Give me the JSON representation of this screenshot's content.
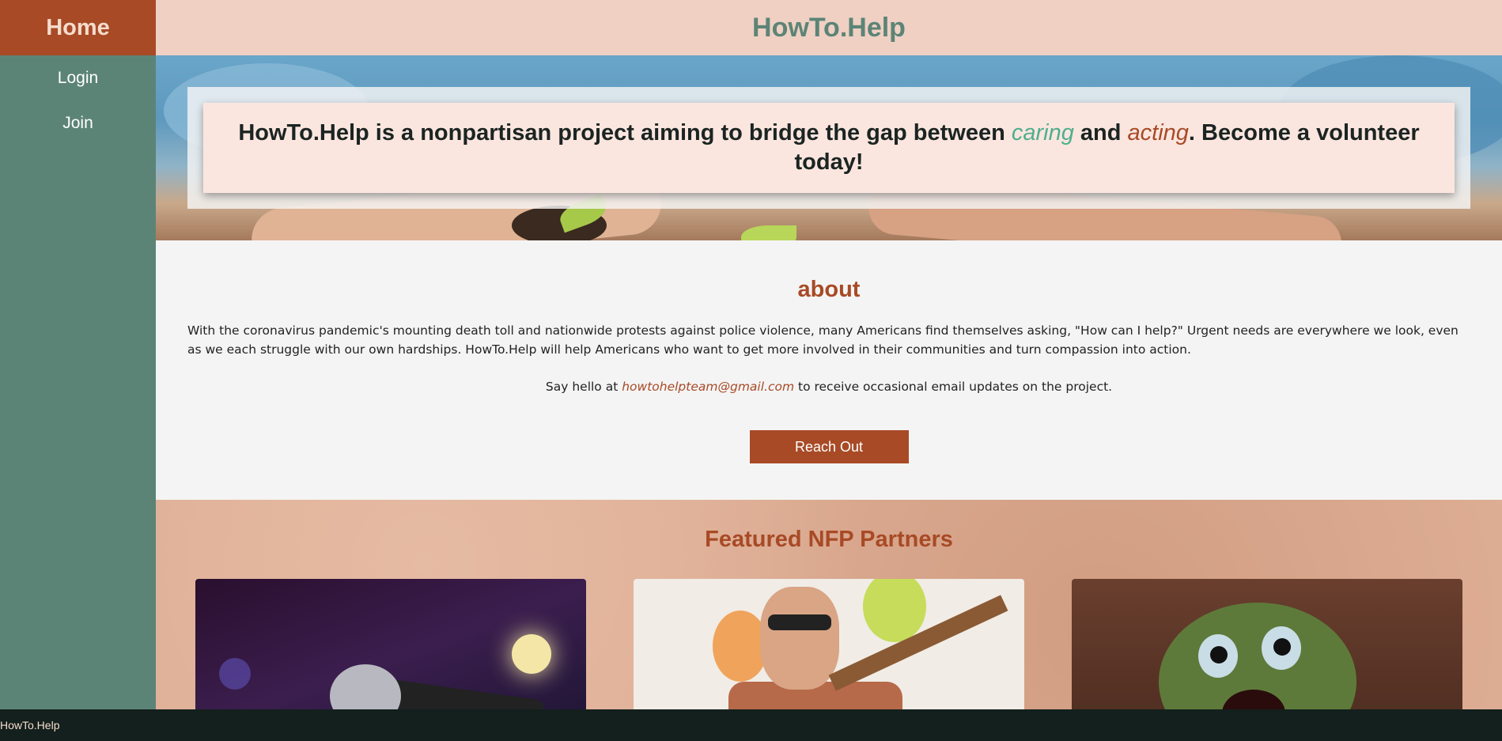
{
  "sidebar": {
    "home_label": "Home",
    "items": [
      {
        "label": "Login"
      },
      {
        "label": "Join"
      }
    ]
  },
  "header": {
    "title": "HowTo.Help"
  },
  "hero": {
    "text_before": "HowTo.Help is a nonpartisan project aiming to bridge the gap between ",
    "word_caring": "caring",
    "text_and": " and ",
    "word_acting": "acting",
    "text_after": ". Become a volunteer today!"
  },
  "about": {
    "heading": "about",
    "description": "With the coronavirus pandemic's mounting death toll and nationwide protests against police violence, many Americans find themselves asking, \"How can I help?\" Urgent needs are everywhere we look, even as we each struggle with our own hardships. HowTo.Help will help Americans who want to get more involved in their communities and turn compassion into action.",
    "hello_prefix": "Say hello at ",
    "email": "howtohelpteam@gmail.com",
    "hello_suffix": " to receive occasional email updates on the project.",
    "button_label": "Reach Out"
  },
  "partners": {
    "heading": "Featured NFP Partners"
  },
  "footer": {
    "text": "HowTo.Help"
  },
  "colors": {
    "sidebar_bg": "#5c8476",
    "accent": "#a84a26",
    "header_bg": "#efd0c3",
    "caring_green": "#4fae8d",
    "footer_bg": "#13201d"
  }
}
